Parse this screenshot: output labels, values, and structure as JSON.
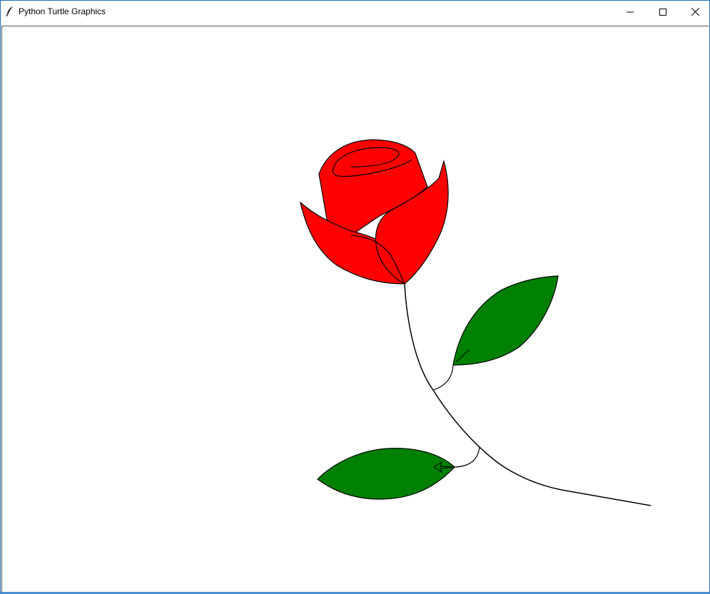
{
  "window": {
    "title": "Python Turtle Graphics",
    "icon": "feather-icon"
  },
  "controls": {
    "minimize": "minimize-icon",
    "maximize": "maximize-icon",
    "close": "close-icon"
  },
  "drawing": {
    "subject": "rose",
    "colors": {
      "petal_fill": "#ff0000",
      "leaf_fill": "#008000",
      "outline": "#000000",
      "background": "#ffffff",
      "window_border": "#1f6fb5"
    }
  }
}
